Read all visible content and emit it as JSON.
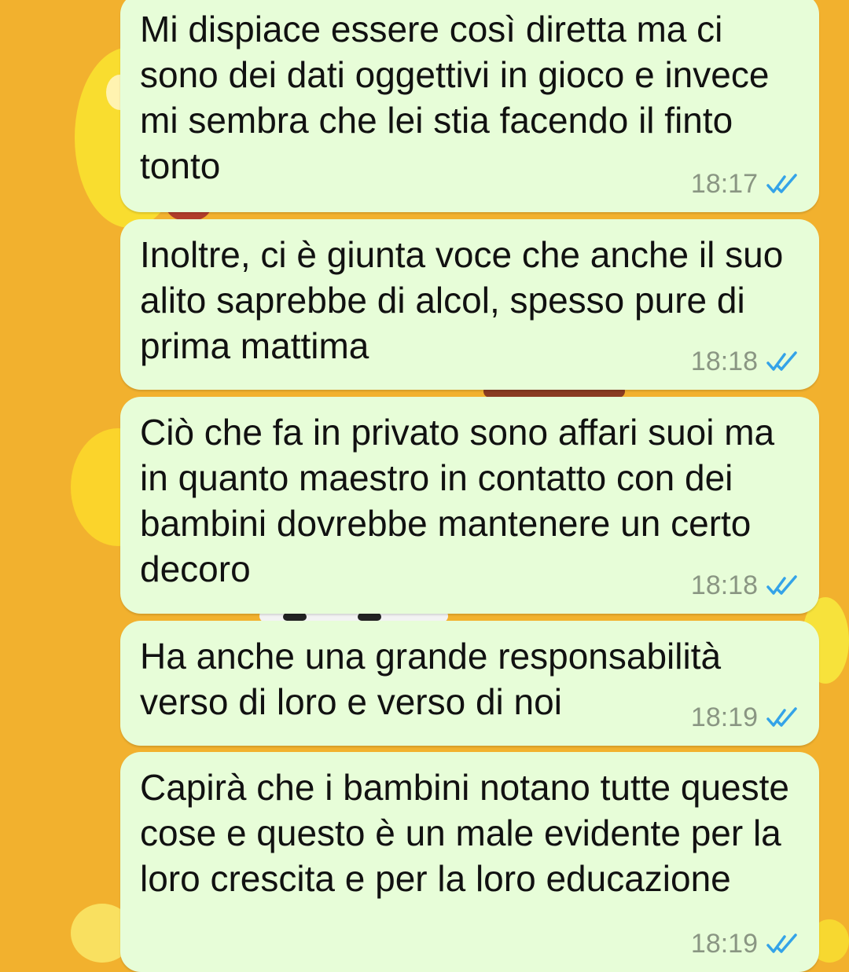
{
  "messages": [
    {
      "text": "Mi dispiace essere così diretta ma ci sono dei dati oggettivi in gioco e invece mi sembra che lei stia facendo il finto tonto",
      "time": "18:17",
      "status_icon": "double-check-read-icon"
    },
    {
      "text": "Inoltre, ci è giunta voce che anche il suo alito saprebbe di alcol, spesso pure di prima mattima",
      "time": "18:18",
      "status_icon": "double-check-read-icon"
    },
    {
      "text": "Ciò che fa in privato sono affari suoi ma in quanto maestro in contatto con dei bambini dovrebbe mantenere un certo decoro",
      "time": "18:18",
      "status_icon": "double-check-read-icon"
    },
    {
      "text": "Ha anche una grande responsabilità verso di loro e verso di noi",
      "time": "18:19",
      "status_icon": "double-check-read-icon"
    },
    {
      "text": "Capirà che i bambini notano tutte queste cose e questo è un male evidente per la loro crescita e per la loro educazione",
      "time": "18:19",
      "status_icon": "double-check-read-icon"
    }
  ],
  "colors": {
    "wallpaper": "#f2b12e",
    "bubble": "#e7fdd8",
    "timestamp": "#8a9683",
    "read_ticks": "#34a3e8"
  }
}
